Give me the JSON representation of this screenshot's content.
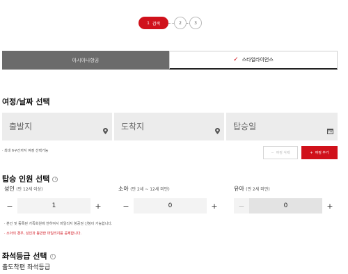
{
  "stepper": {
    "step1_number": "1",
    "step1_label": "검색",
    "step2_number": "2",
    "step3_number": "3"
  },
  "tabs": {
    "airline1": "아시아나항공",
    "airline2": "스타얼라이언스",
    "check_icon": "✓"
  },
  "itinerary": {
    "title": "여정/날짜 선택",
    "departure_placeholder": "출발지",
    "arrival_placeholder": "도착지",
    "date_placeholder": "탑승일",
    "note": "· 최대 6구간까지 여정 선택가능",
    "delete_label": "여정 삭제",
    "delete_icon": "−",
    "add_label": "여정 추가",
    "add_icon": "+"
  },
  "passengers": {
    "title": "탑승 인원 선택",
    "info_icon": "i",
    "adult_label": "성인",
    "adult_sub": "(만 12세 이상)",
    "adult_value": "1",
    "child_label": "소아",
    "child_sub": "(만 2세 ~ 12세 미만)",
    "child_value": "0",
    "infant_label": "유아",
    "infant_sub": "(만 2세 미만)",
    "infant_value": "0",
    "minus": "−",
    "plus": "+",
    "note1": "· 본인 및 등록된 가족회원에 한하여서 마일리지 항공권 신청이 가능합니다.",
    "note2": "· 소아의 경우, 성인과 동반한 마일리지를 공제합니다."
  },
  "seat": {
    "title": "좌석등급 선택",
    "subtitle": "출도착편 좌석등급"
  },
  "colors": {
    "accent": "#d0111b",
    "tab_inactive": "#6b6b6b",
    "field_bg": "#ececec"
  }
}
